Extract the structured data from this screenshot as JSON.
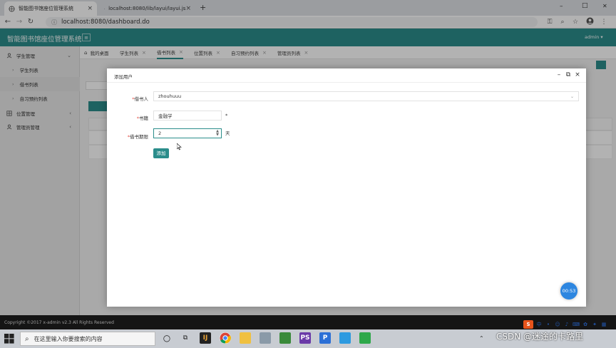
{
  "browser": {
    "tabs": [
      {
        "title": "智能图书馆座位管理系统",
        "active": true
      },
      {
        "title": "localhost:8080/lib/layui/layui.js",
        "active": false
      }
    ],
    "new_tab": "+",
    "url": "localhost:8080/dashboard.do",
    "window_controls": {
      "minimize": "–",
      "maximize": "□",
      "close": "✕"
    }
  },
  "app": {
    "title": "智能图书馆座位管理系统",
    "menu_toggle": "≡",
    "user": "admin ▾"
  },
  "sidebar": {
    "items": [
      {
        "label": "学生管理",
        "icon": "user-icon",
        "arrow": "⌄"
      },
      {
        "label": "学生列表",
        "icon": "chevron-right-icon",
        "sub": true
      },
      {
        "label": "借书列表",
        "icon": "chevron-right-icon",
        "sub": true
      },
      {
        "label": "自习预约列表",
        "icon": "chevron-right-icon",
        "sub": true
      },
      {
        "label": "位置管理",
        "icon": "grid-icon",
        "arrow": "‹"
      },
      {
        "label": "管理员管理",
        "icon": "user-icon",
        "arrow": "‹"
      }
    ]
  },
  "content_tabs": [
    {
      "label": "我的桌面",
      "closable": false
    },
    {
      "label": "学生列表",
      "closable": true
    },
    {
      "label": "借书列表",
      "closable": true,
      "active": true
    },
    {
      "label": "位置列表",
      "closable": true
    },
    {
      "label": "自习预约列表",
      "closable": true
    },
    {
      "label": "管理员列表",
      "closable": true
    }
  ],
  "modal": {
    "title": "添加用户",
    "fields": {
      "borrower": {
        "label": "借书人",
        "value": "zhouhuuu"
      },
      "book": {
        "label": "书籍",
        "value": "金融学",
        "suffix": "*"
      },
      "period": {
        "label": "借书期限",
        "value": "2",
        "suffix": "天"
      }
    },
    "required_mark": "*",
    "submit_label": "添加",
    "timer": "00:53"
  },
  "footer": {
    "copyright": "Copyright ©2017 x-admin v2.3 All Rights Reserved"
  },
  "taskbar": {
    "search_placeholder": "在这里输入你要搜索的内容",
    "watermark": "CSDN @迷途的卡路里"
  },
  "colors": {
    "primary": "#2b8d8b",
    "header": "#2b8d8b",
    "danger": "#e54d42",
    "timer": "#2d86e0"
  }
}
